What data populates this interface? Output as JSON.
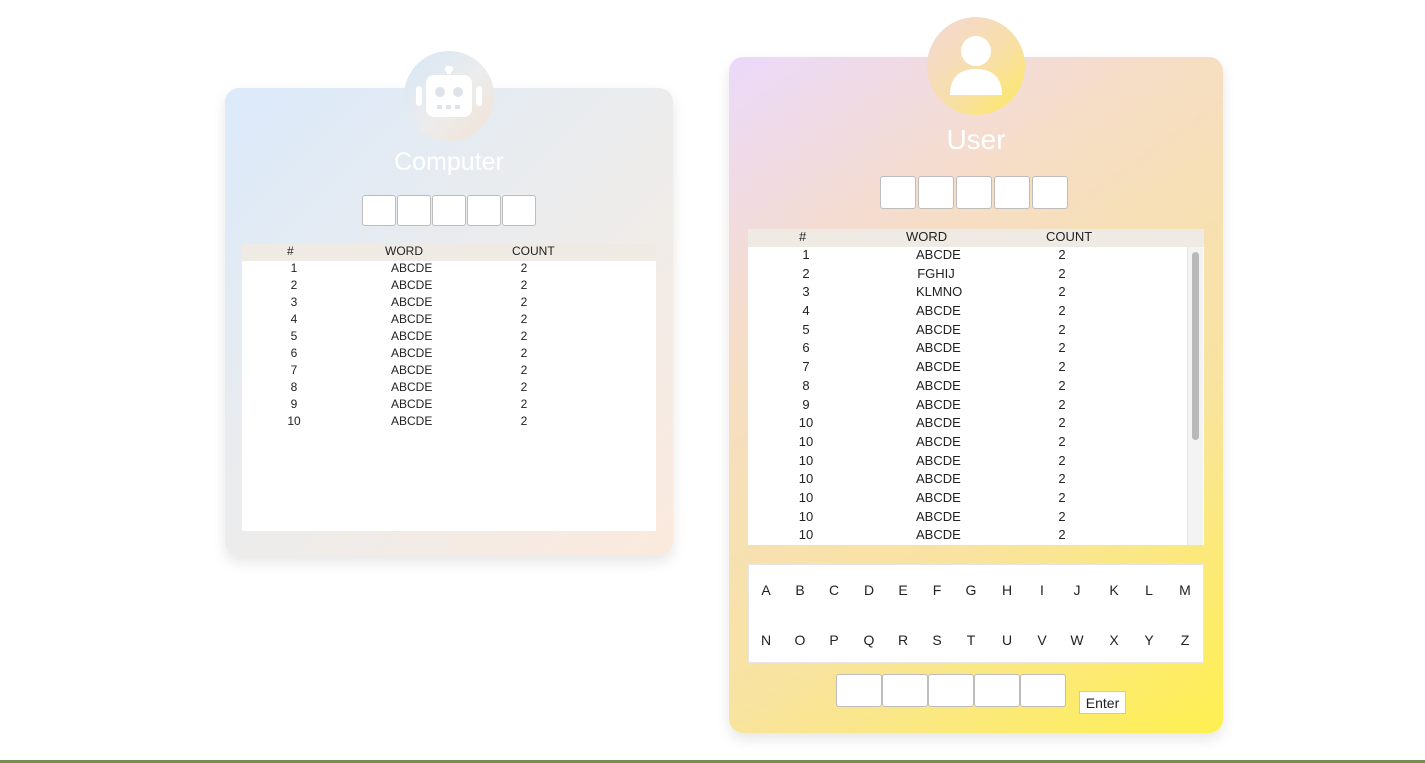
{
  "computer": {
    "title": "Computer",
    "table": {
      "headers": [
        "#",
        "WORD",
        "COUNT"
      ],
      "rows": [
        [
          "1",
          "ABCDE",
          "2"
        ],
        [
          "2",
          "ABCDE",
          "2"
        ],
        [
          "3",
          "ABCDE",
          "2"
        ],
        [
          "4",
          "ABCDE",
          "2"
        ],
        [
          "5",
          "ABCDE",
          "2"
        ],
        [
          "6",
          "ABCDE",
          "2"
        ],
        [
          "7",
          "ABCDE",
          "2"
        ],
        [
          "8",
          "ABCDE",
          "2"
        ],
        [
          "9",
          "ABCDE",
          "2"
        ],
        [
          "10",
          "ABCDE",
          "2"
        ]
      ]
    },
    "avatar_icon": "robot-icon"
  },
  "user": {
    "title": "User",
    "avatar_icon": "user-icon",
    "table": {
      "headers": [
        "#",
        "WORD",
        "COUNT"
      ],
      "rows": [
        [
          "1",
          "ABCDE",
          "2"
        ],
        [
          "2",
          "FGHIJ",
          "2"
        ],
        [
          "3",
          "KLMNO",
          "2"
        ],
        [
          "4",
          "ABCDE",
          "2"
        ],
        [
          "5",
          "ABCDE",
          "2"
        ],
        [
          "6",
          "ABCDE",
          "2"
        ],
        [
          "7",
          "ABCDE",
          "2"
        ],
        [
          "8",
          "ABCDE",
          "2"
        ],
        [
          "9",
          "ABCDE",
          "2"
        ],
        [
          "10",
          "ABCDE",
          "2"
        ],
        [
          "10",
          "ABCDE",
          "2"
        ],
        [
          "10",
          "ABCDE",
          "2"
        ],
        [
          "10",
          "ABCDE",
          "2"
        ],
        [
          "10",
          "ABCDE",
          "2"
        ],
        [
          "10",
          "ABCDE",
          "2"
        ],
        [
          "10",
          "ABCDE",
          "2"
        ]
      ]
    },
    "keyboard": {
      "rows": [
        [
          "A",
          "B",
          "C",
          "D",
          "E",
          "F",
          "G",
          "H",
          "I",
          "J",
          "K",
          "L",
          "M"
        ],
        [
          "N",
          "O",
          "P",
          "Q",
          "R",
          "S",
          "T",
          "U",
          "V",
          "W",
          "X",
          "Y",
          "Z"
        ]
      ]
    },
    "enter_label": "Enter"
  }
}
